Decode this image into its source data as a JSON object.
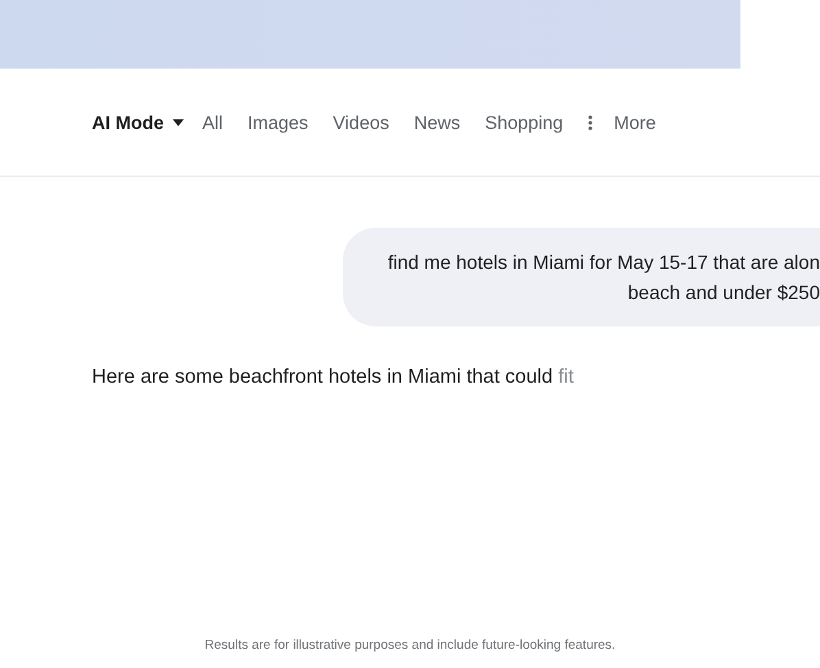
{
  "tabs": [
    {
      "label": "AI Mode",
      "selected": true,
      "kind": "dropdown"
    },
    {
      "label": "All",
      "selected": false,
      "kind": "plain"
    },
    {
      "label": "Images",
      "selected": false,
      "kind": "plain"
    },
    {
      "label": "Videos",
      "selected": false,
      "kind": "plain"
    },
    {
      "label": "News",
      "selected": false,
      "kind": "plain"
    },
    {
      "label": "Shopping",
      "selected": false,
      "kind": "plain"
    },
    {
      "label": "More",
      "selected": false,
      "kind": "more"
    }
  ],
  "query": {
    "lines": [
      "find me hotels in Miami for May 15-17 that are alon",
      "beach and under $250"
    ]
  },
  "answer": {
    "text": "Here are some beachfront hotels in Miami that could ",
    "pending_text": "fit"
  },
  "footer": "Results are for illustrative purposes and include future-looking features."
}
